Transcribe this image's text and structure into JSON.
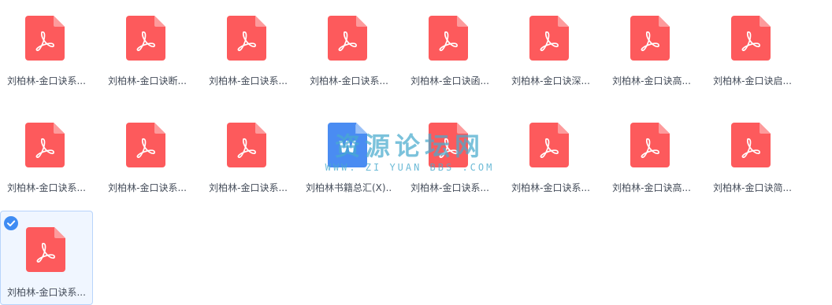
{
  "files": [
    {
      "name": "刘柏林-金口诀系...",
      "type": "pdf",
      "selected": false
    },
    {
      "name": "刘柏林-金口诀断...",
      "type": "pdf",
      "selected": false
    },
    {
      "name": "刘柏林-金口诀系...",
      "type": "pdf",
      "selected": false
    },
    {
      "name": "刘柏林-金口诀系...",
      "type": "pdf",
      "selected": false
    },
    {
      "name": "刘柏林-金口诀函...",
      "type": "pdf",
      "selected": false
    },
    {
      "name": "刘柏林-金口诀深...",
      "type": "pdf",
      "selected": false
    },
    {
      "name": "刘柏林-金口诀高...",
      "type": "pdf",
      "selected": false
    },
    {
      "name": "刘柏林-金口诀启...",
      "type": "pdf",
      "selected": false
    },
    {
      "name": "刘柏林-金口诀系...",
      "type": "pdf",
      "selected": false
    },
    {
      "name": "刘柏林-金口诀系...",
      "type": "pdf",
      "selected": false
    },
    {
      "name": "刘柏林-金口诀系...",
      "type": "pdf",
      "selected": false
    },
    {
      "name": "刘柏林书籍总汇(X)...",
      "type": "doc",
      "selected": false
    },
    {
      "name": "刘柏林-金口诀系...",
      "type": "pdf",
      "selected": false
    },
    {
      "name": "刘柏林-金口诀系...",
      "type": "pdf",
      "selected": false
    },
    {
      "name": "刘柏林-金口诀高...",
      "type": "pdf",
      "selected": false
    },
    {
      "name": "刘柏林-金口诀简...",
      "type": "pdf",
      "selected": false
    },
    {
      "name": "刘柏林-金口诀系...",
      "type": "pdf",
      "selected": true
    }
  ],
  "watermark": {
    "title": "资源论坛网",
    "subtitle": "WWW. ZI YUAN BBS .COM"
  },
  "colors": {
    "pdf_icon": "#fd5a5c",
    "pdf_fold": "#fd9b9c",
    "doc_icon": "#4a8cf2",
    "selection_bg": "#f0f6ff",
    "selection_border": "#b8d4fb",
    "check": "#3f8cf3",
    "label_text": "#454d5a",
    "watermark": "#48aacd"
  },
  "icons": {
    "pdf": "pdf-file-icon",
    "doc": "word-file-icon",
    "check": "checkmark-icon"
  }
}
